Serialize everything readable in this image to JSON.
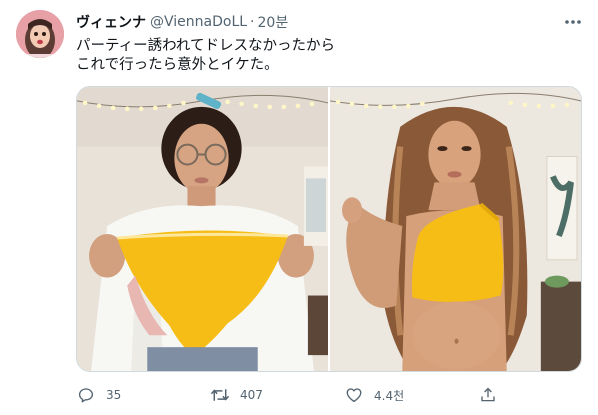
{
  "tweet": {
    "display_name": "ヴィェンナ",
    "handle": "@ViennaDoLL",
    "separator": "·",
    "timestamp": "20분",
    "text": "パーティー誘われてドレスなかったから\nこれで行ったら意外とイケた。"
  },
  "media": [
    {
      "subject": "woman holding yellow bikini bottom",
      "top_color": "#ffffff",
      "item_color": "#f6bd16"
    },
    {
      "subject": "woman wearing bikini bottom as top",
      "item_color": "#f6bd16"
    }
  ],
  "actions": {
    "reply_count": "35",
    "retweet_count": "407",
    "like_count": "4.4천",
    "share_icon": "share-icon"
  },
  "colors": {
    "text_primary": "#0f1419",
    "text_secondary": "#536471",
    "border": "#cfd9de"
  }
}
